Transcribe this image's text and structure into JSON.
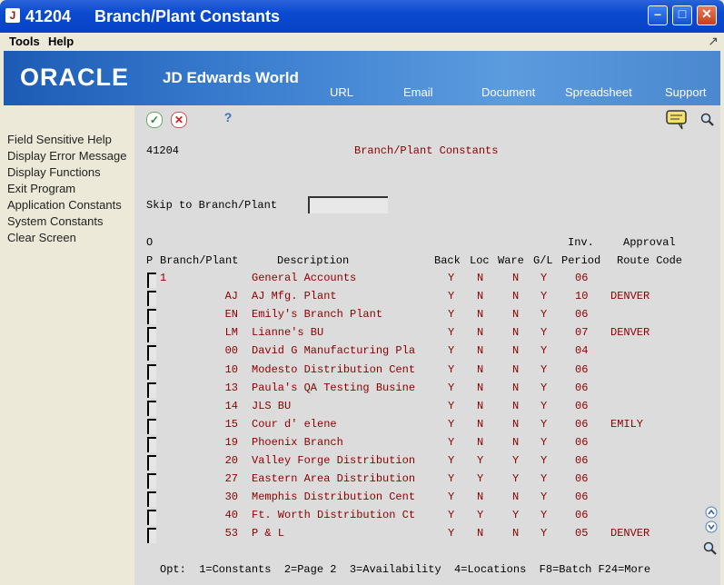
{
  "window": {
    "number": "41204",
    "title": "Branch/Plant Constants",
    "app_icon": "J"
  },
  "menu": {
    "tools": "Tools",
    "help": "Help"
  },
  "banner": {
    "logo": "ORACLE",
    "product": "JD Edwards World",
    "nav": [
      "URL",
      "Email",
      "Document",
      "Spreadsheet",
      "Support"
    ]
  },
  "sidebar": {
    "items": [
      "Field Sensitive Help",
      "Display Error Message",
      "Display Functions",
      "Exit Program",
      "Application Constants",
      "System Constants",
      "Clear Screen"
    ]
  },
  "toolbar": {
    "help_glyph": "?"
  },
  "form": {
    "program_id": "41204",
    "screen_title": "Branch/Plant Constants",
    "skip_label": "Skip to Branch/Plant",
    "skip_value": "",
    "header1": {
      "o": "O",
      "inv": "Inv.",
      "approval": "Approval"
    },
    "header2": {
      "p": "P",
      "branch": "Branch/Plant",
      "description": "Description",
      "back": "Back",
      "loc": "Loc",
      "ware": "Ware",
      "gl": "G/L",
      "period": "Period",
      "route": "Route Code"
    },
    "footer": "Opt:  1=Constants  2=Page 2  3=Availability  4=Locations  F8=Batch F24=More"
  },
  "rows": [
    {
      "bp": "1",
      "desc": "General Accounts",
      "back": "Y",
      "loc": "N",
      "ware": "N",
      "gl": "Y",
      "period": "06",
      "route": ""
    },
    {
      "bp": "AJ",
      "desc": "AJ Mfg. Plant",
      "back": "Y",
      "loc": "N",
      "ware": "N",
      "gl": "Y",
      "period": "10",
      "route": "DENVER"
    },
    {
      "bp": "EN",
      "desc": "Emily's Branch Plant",
      "back": "Y",
      "loc": "N",
      "ware": "N",
      "gl": "Y",
      "period": "06",
      "route": ""
    },
    {
      "bp": "LM",
      "desc": "Lianne's BU",
      "back": "Y",
      "loc": "N",
      "ware": "N",
      "gl": "Y",
      "period": "07",
      "route": "DENVER"
    },
    {
      "bp": "00",
      "desc": "David G Manufacturing Pla",
      "back": "Y",
      "loc": "N",
      "ware": "N",
      "gl": "Y",
      "period": "04",
      "route": ""
    },
    {
      "bp": "10",
      "desc": "Modesto Distribution Cent",
      "back": "Y",
      "loc": "N",
      "ware": "N",
      "gl": "Y",
      "period": "06",
      "route": ""
    },
    {
      "bp": "13",
      "desc": "Paula's QA Testing Busine",
      "back": "Y",
      "loc": "N",
      "ware": "N",
      "gl": "Y",
      "period": "06",
      "route": ""
    },
    {
      "bp": "14",
      "desc": "JLS BU",
      "back": "Y",
      "loc": "N",
      "ware": "N",
      "gl": "Y",
      "period": "06",
      "route": ""
    },
    {
      "bp": "15",
      "desc": "Cour d' elene",
      "back": "Y",
      "loc": "N",
      "ware": "N",
      "gl": "Y",
      "period": "06",
      "route": "EMILY"
    },
    {
      "bp": "19",
      "desc": "Phoenix Branch",
      "back": "Y",
      "loc": "N",
      "ware": "N",
      "gl": "Y",
      "period": "06",
      "route": ""
    },
    {
      "bp": "20",
      "desc": "Valley Forge Distribution",
      "back": "Y",
      "loc": "Y",
      "ware": "Y",
      "gl": "Y",
      "period": "06",
      "route": ""
    },
    {
      "bp": "27",
      "desc": "Eastern Area Distribution",
      "back": "Y",
      "loc": "Y",
      "ware": "Y",
      "gl": "Y",
      "period": "06",
      "route": ""
    },
    {
      "bp": "30",
      "desc": "Memphis Distribution Cent",
      "back": "Y",
      "loc": "N",
      "ware": "N",
      "gl": "Y",
      "period": "06",
      "route": ""
    },
    {
      "bp": "40",
      "desc": "Ft. Worth Distribution Ct",
      "back": "Y",
      "loc": "Y",
      "ware": "Y",
      "gl": "Y",
      "period": "06",
      "route": ""
    },
    {
      "bp": "53",
      "desc": "P & L",
      "back": "Y",
      "loc": "N",
      "ware": "N",
      "gl": "Y",
      "period": "05",
      "route": "DENVER"
    }
  ]
}
